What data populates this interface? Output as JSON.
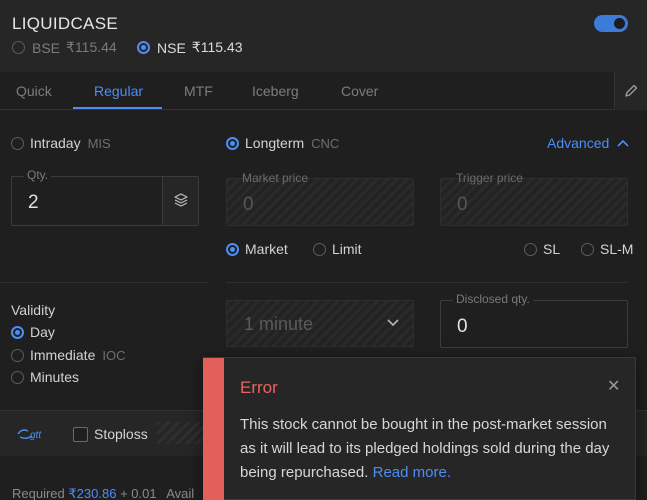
{
  "header": {
    "title": "LIQUIDCASE",
    "toggle_on": true,
    "exchanges": [
      {
        "name": "BSE",
        "price": "₹115.44",
        "selected": false
      },
      {
        "name": "NSE",
        "price": "₹115.43",
        "selected": true
      }
    ]
  },
  "tabs": [
    "Quick",
    "Regular",
    "MTF",
    "Iceberg",
    "Cover"
  ],
  "active_tab": "Regular",
  "product": {
    "intraday": {
      "label": "Intraday",
      "code": "MIS",
      "selected": false
    },
    "longterm": {
      "label": "Longterm",
      "code": "CNC",
      "selected": true
    }
  },
  "advanced_label": "Advanced",
  "fields": {
    "qty": {
      "label": "Qty.",
      "value": "2"
    },
    "market_price": {
      "label": "Market price",
      "value": "0"
    },
    "trigger_price": {
      "label": "Trigger price",
      "value": "0"
    },
    "disclosed_qty": {
      "label": "Disclosed qty.",
      "value": "0"
    }
  },
  "order_types": [
    {
      "label": "Market",
      "selected": true
    },
    {
      "label": "Limit",
      "selected": false
    },
    {
      "label": "SL",
      "selected": false
    },
    {
      "label": "SL-M",
      "selected": false
    }
  ],
  "validity": {
    "title": "Validity",
    "options": [
      {
        "label": "Day",
        "code": "",
        "selected": true
      },
      {
        "label": "Immediate",
        "code": "IOC",
        "selected": false
      },
      {
        "label": "Minutes",
        "code": "",
        "selected": false
      }
    ],
    "minutes_value": "1 minute"
  },
  "footer": {
    "stoploss_label": "Stoploss",
    "gtt_label": "gtt",
    "required_label": "Required",
    "required_amount": "₹230.86",
    "required_extra": "+ 0.01",
    "available_label": "Avail"
  },
  "toast": {
    "title": "Error",
    "message": "This stock cannot be bought in the post-market session as it will lead to its pledged holdings sold during the day being repurchased.",
    "link": "Read more."
  },
  "colors": {
    "accent": "#4d8ef5",
    "error": "#e25f5b",
    "background": "#1f1f1f"
  }
}
